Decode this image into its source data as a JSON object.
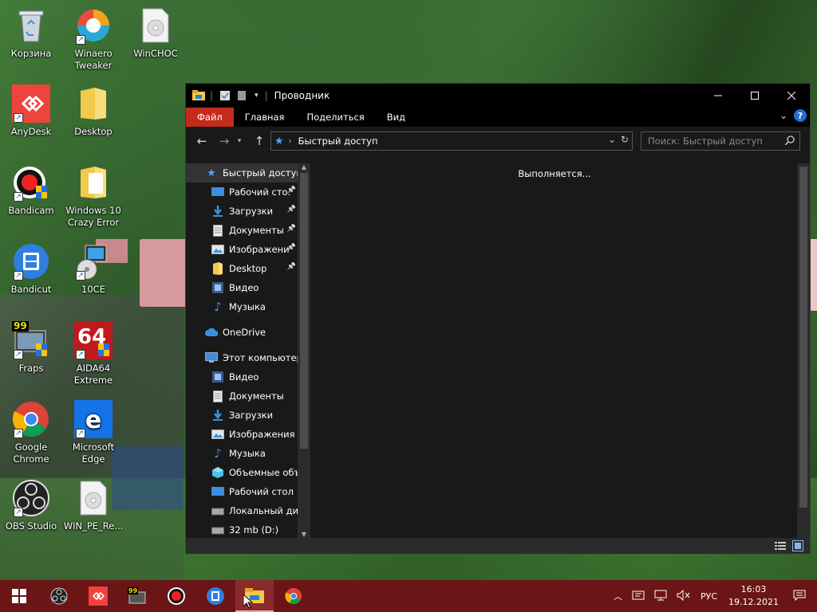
{
  "desktop": {
    "icons": [
      {
        "label": "Корзина"
      },
      {
        "label": "Winaero Tweaker"
      },
      {
        "label": "WinCHOC"
      },
      {
        "label": "AnyDesk"
      },
      {
        "label": "Desktop"
      },
      {
        "label": "Bandicam"
      },
      {
        "label": "Windows 10 Crazy Error"
      },
      {
        "label": "Bandicut"
      },
      {
        "label": "10CE"
      },
      {
        "label": "Fraps"
      },
      {
        "label": "AIDA64 Extreme"
      },
      {
        "label": "Google Chrome"
      },
      {
        "label": "Microsoft Edge"
      },
      {
        "label": "OBS Studio"
      },
      {
        "label": "WIN_PE_Re..."
      }
    ],
    "fraps_badge": "99",
    "aida_badge": "64"
  },
  "explorer": {
    "title": "Проводник",
    "ribbon_tabs": [
      "Файл",
      "Главная",
      "Поделиться",
      "Вид"
    ],
    "address": "Быстрый доступ",
    "search_placeholder": "Поиск: Быстрый доступ",
    "loading_text": "Выполняется...",
    "nav": [
      {
        "label": "Быстрый доступ",
        "icon": "star-icon",
        "selected": true
      },
      {
        "label": "Рабочий сто.",
        "icon": "desktop-folder-icon",
        "pinned": true
      },
      {
        "label": "Загрузки",
        "icon": "download-icon",
        "pinned": true
      },
      {
        "label": "Документы",
        "icon": "document-icon",
        "pinned": true
      },
      {
        "label": "Изображени",
        "icon": "pictures-icon",
        "pinned": true
      },
      {
        "label": "Desktop",
        "icon": "folder-icon",
        "pinned": true
      },
      {
        "label": "Видео",
        "icon": "video-icon"
      },
      {
        "label": "Музыка",
        "icon": "music-icon"
      },
      {
        "label": "OneDrive",
        "icon": "cloud-icon"
      },
      {
        "label": "Этот компьютер",
        "icon": "computer-icon"
      },
      {
        "label": "Видео",
        "icon": "video-icon"
      },
      {
        "label": "Документы",
        "icon": "document-icon"
      },
      {
        "label": "Загрузки",
        "icon": "download-icon"
      },
      {
        "label": "Изображения",
        "icon": "pictures-icon"
      },
      {
        "label": "Музыка",
        "icon": "music-icon"
      },
      {
        "label": "Объемные объ",
        "icon": "3d-objects-icon"
      },
      {
        "label": "Рабочий стол",
        "icon": "desktop-folder-icon"
      },
      {
        "label": "Локальный дис",
        "icon": "drive-icon"
      },
      {
        "label": "32 mb (D:)",
        "icon": "drive-icon"
      }
    ]
  },
  "taskbar": {
    "fraps_badge": "99",
    "language": "РУС",
    "time": "16:03",
    "date": "19.12.2021"
  },
  "colors": {
    "taskbar": "#6b1516",
    "ribbon_active": "#c42b1c",
    "window_bg": "#191919"
  }
}
